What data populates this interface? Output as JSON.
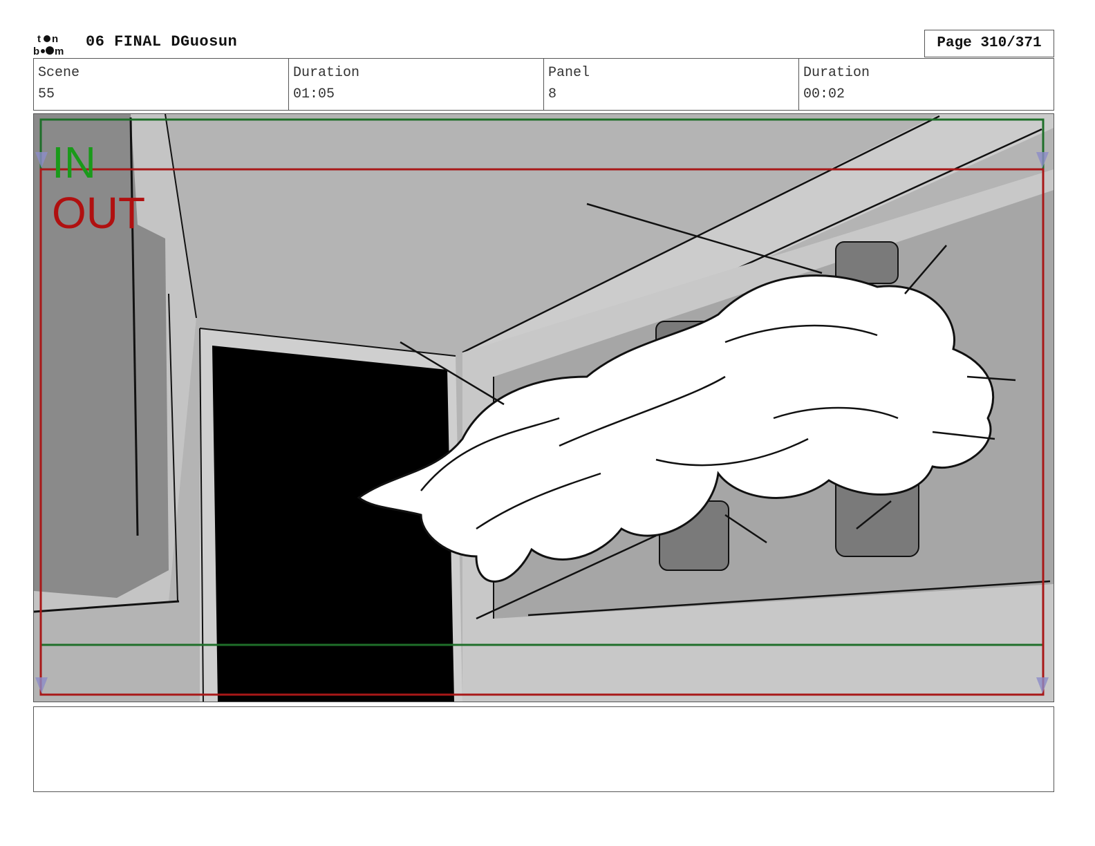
{
  "header": {
    "logo_text": "toon boom",
    "title": "06 FINAL DGuosun",
    "page": "Page 310/371"
  },
  "info": [
    {
      "label": "Scene",
      "value": "55"
    },
    {
      "label": "Duration",
      "value": "01:05"
    },
    {
      "label": "Panel",
      "value": "8"
    },
    {
      "label": "Duration",
      "value": "00:02"
    }
  ],
  "panel": {
    "in_label": "IN",
    "out_label": "OUT",
    "in_color": "#1a9a1a",
    "out_color": "#b01010"
  },
  "notes": ""
}
